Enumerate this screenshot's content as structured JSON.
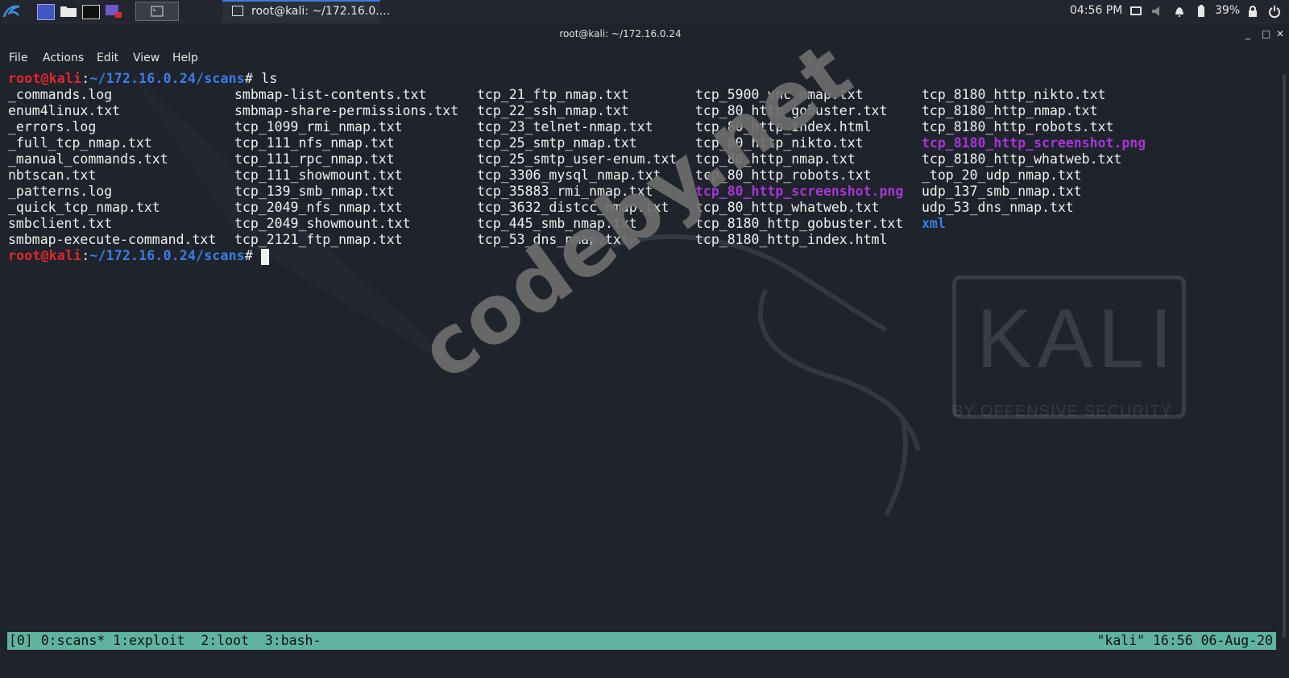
{
  "panel": {
    "task_active_label": "root@kali: ~/172.16.0....",
    "clock": "04:56 PM",
    "battery": "39%"
  },
  "window": {
    "title": "root@kali: ~/172.16.0.24",
    "controls": [
      "_",
      "□",
      "✕"
    ]
  },
  "menu": [
    "File",
    "Actions",
    "Edit",
    "View",
    "Help"
  ],
  "terminal": {
    "prompt_user": "root@kali",
    "prompt_sep": ":",
    "prompt_path": "~/172.16.0.24/scans",
    "prompt_sym": "#",
    "command": " ls",
    "columns": [
      [
        "_commands.log",
        "enum4linux.txt",
        "_errors.log",
        "_full_tcp_nmap.txt",
        "_manual_commands.txt",
        "nbtscan.txt",
        "_patterns.log",
        "_quick_tcp_nmap.txt",
        "smbclient.txt",
        "smbmap-execute-command.txt"
      ],
      [
        "smbmap-list-contents.txt",
        "smbmap-share-permissions.txt",
        "tcp_1099_rmi_nmap.txt",
        "tcp_111_nfs_nmap.txt",
        "tcp_111_rpc_nmap.txt",
        "tcp_111_showmount.txt",
        "tcp_139_smb_nmap.txt",
        "tcp_2049_nfs_nmap.txt",
        "tcp_2049_showmount.txt",
        "tcp_2121_ftp_nmap.txt"
      ],
      [
        "tcp_21_ftp_nmap.txt",
        "tcp_22_ssh_nmap.txt",
        "tcp_23_telnet-nmap.txt",
        "tcp_25_smtp_nmap.txt",
        "tcp_25_smtp_user-enum.txt",
        "tcp_3306_mysql_nmap.txt",
        "tcp_35883_rmi_nmap.txt",
        "tcp_3632_distcc_nmap.txt",
        "tcp_445_smb_nmap.txt",
        "tcp_53_dns_nmap.txt"
      ],
      [
        "tcp_5900_vnc_nmap.txt",
        "tcp_80_http_gobuster.txt",
        "tcp_80_http_index.html",
        "tcp_80_http_nikto.txt",
        "tcp_80_http_nmap.txt",
        "tcp_80_http_robots.txt",
        "tcp_80_http_screenshot.png",
        "tcp_80_http_whatweb.txt",
        "tcp_8180_http_gobuster.txt",
        "tcp_8180_http_index.html"
      ],
      [
        "tcp_8180_http_nikto.txt",
        "tcp_8180_http_nmap.txt",
        "tcp_8180_http_robots.txt",
        "tcp_8180_http_screenshot.png",
        "tcp_8180_http_whatweb.txt",
        "_top_20_udp_nmap.txt",
        "udp_137_smb_nmap.txt",
        "udp_53_dns_nmap.txt",
        "xml"
      ]
    ],
    "colors": {
      "image_file": "#a736d6",
      "directory": "#3b7ee8",
      "prompt_user": "#e0262f"
    }
  },
  "watermarks": {
    "codeby": "codeby.net",
    "kali": "KALI",
    "kali_sub": "BY OFFENSIVE SECURITY"
  },
  "tmux": {
    "left": "[0] 0:scans* 1:exploit  2:loot  3:bash-",
    "right": "\"kali\" 16:56 06-Aug-20"
  }
}
